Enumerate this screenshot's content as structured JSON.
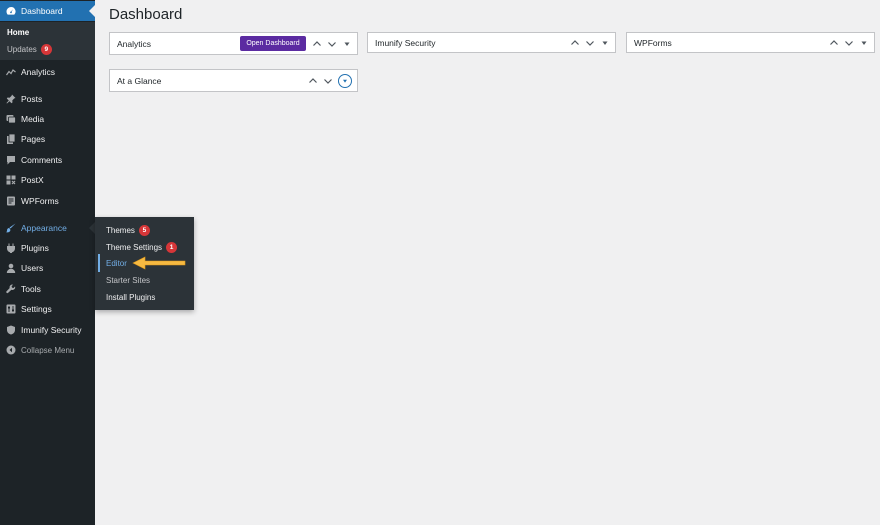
{
  "sidebar": {
    "dashboard": "Dashboard",
    "home": "Home",
    "updates": "Updates",
    "updates_count": "9",
    "items": [
      {
        "label": "Analytics",
        "icon": "analytics-icon"
      },
      {
        "label": "Posts",
        "icon": "pushpin-icon"
      },
      {
        "label": "Media",
        "icon": "media-icon"
      },
      {
        "label": "Pages",
        "icon": "pages-icon"
      },
      {
        "label": "Comments",
        "icon": "comment-icon"
      },
      {
        "label": "PostX",
        "icon": "postx-icon"
      },
      {
        "label": "WPForms",
        "icon": "wpforms-icon"
      },
      {
        "label": "Appearance",
        "icon": "brush-icon"
      },
      {
        "label": "Plugins",
        "icon": "plugin-icon"
      },
      {
        "label": "Users",
        "icon": "users-icon"
      },
      {
        "label": "Tools",
        "icon": "wrench-icon"
      },
      {
        "label": "Settings",
        "icon": "settings-icon"
      },
      {
        "label": "Imunify Security",
        "icon": "shield-icon"
      },
      {
        "label": "Collapse Menu",
        "icon": "collapse-icon"
      }
    ]
  },
  "appearance_submenu": {
    "themes": "Themes",
    "themes_count": "5",
    "theme_settings": "Theme Settings",
    "theme_settings_count": "1",
    "editor": "Editor",
    "starter_sites": "Starter Sites",
    "install_plugins": "Install Plugins"
  },
  "main": {
    "title": "Dashboard",
    "widgets": {
      "analytics": {
        "title": "Analytics",
        "button": "Open Dashboard"
      },
      "imunify": {
        "title": "Imunify Security"
      },
      "wpforms": {
        "title": "WPForms"
      },
      "at_a_glance": {
        "title": "At a Glance"
      }
    }
  },
  "colors": {
    "sidebar_bg": "#1d2327",
    "active_blue": "#2271b1",
    "button_purple": "#5b2ba1",
    "badge_red": "#d63638",
    "annotation_arrow": "#f5b942"
  }
}
